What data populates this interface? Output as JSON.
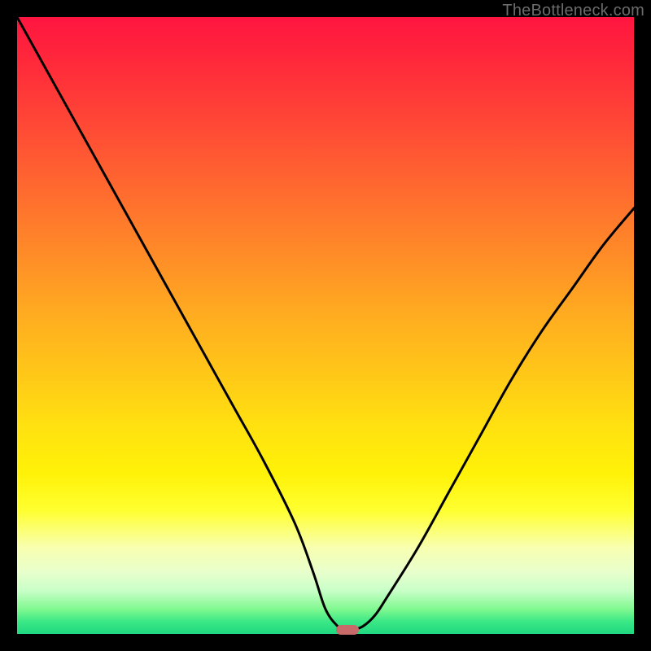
{
  "attribution": "TheBottleneck.com",
  "chart_data": {
    "type": "line",
    "title": "",
    "xlabel": "",
    "ylabel": "",
    "xlim": [
      0,
      100
    ],
    "ylim": [
      0,
      100
    ],
    "series": [
      {
        "name": "bottleneck-curve",
        "x": [
          0,
          5,
          10,
          15,
          20,
          25,
          30,
          35,
          40,
          45,
          48,
          50,
          52,
          53,
          54,
          56,
          58,
          60,
          65,
          70,
          75,
          80,
          85,
          90,
          95,
          100
        ],
        "values": [
          100,
          91,
          82,
          73,
          64,
          55,
          46,
          37,
          28,
          18,
          10,
          4,
          1.2,
          0.6,
          0.6,
          1.2,
          3,
          6,
          14,
          23,
          32,
          41,
          49,
          56,
          63,
          69
        ]
      }
    ],
    "marker": {
      "x": 53.5,
      "y": 0.6
    },
    "gradient_stops": [
      {
        "pct": 0,
        "color": "#ff1540"
      },
      {
        "pct": 50,
        "color": "#ffc818"
      },
      {
        "pct": 80,
        "color": "#ffff30"
      },
      {
        "pct": 100,
        "color": "#1fd880"
      }
    ]
  }
}
